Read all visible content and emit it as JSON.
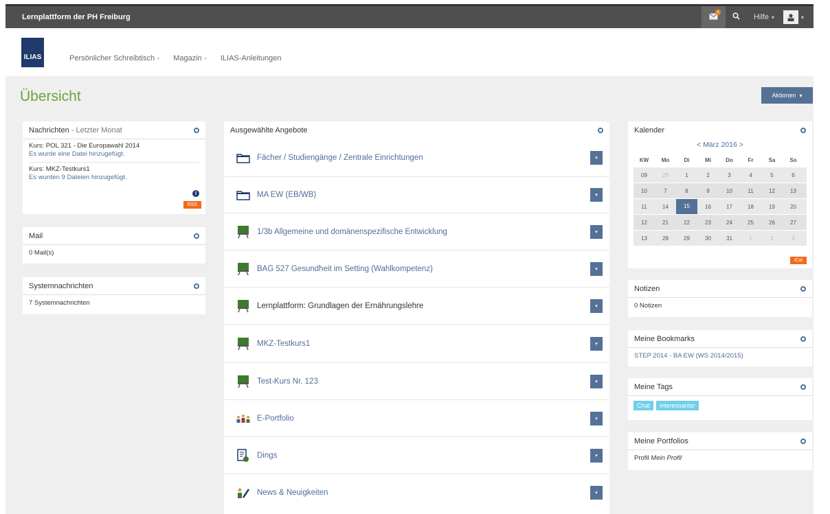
{
  "topbar": {
    "brand": "Lernplattform der PH Freiburg",
    "help_label": "Hilfe",
    "caret": "▾",
    "mail_badge": "!"
  },
  "header": {
    "logo_text": "ILIAS",
    "nav": [
      {
        "label": "Persönlicher Schreibtisch",
        "has_menu": true
      },
      {
        "label": "Magazin",
        "has_menu": true
      },
      {
        "label": "ILIAS-Anleitungen",
        "has_menu": false
      }
    ]
  },
  "page": {
    "title": "Übersicht",
    "actions_label": "Aktionen"
  },
  "left": {
    "news": {
      "title": "Nachrichten",
      "period": "- Letzter Monat",
      "items": [
        {
          "course": "Kurs: POL 321 - Die Europawahl 2014",
          "text": "Es wurde eine Datei hinzugefügt."
        },
        {
          "course": "Kurs: MKZ-Testkurs1",
          "text": "Es wurden 9 Dateien hinzugefügt."
        }
      ],
      "info": "i",
      "rss": "RSS"
    },
    "mail": {
      "title": "Mail",
      "text": "0 Mail(s)"
    },
    "system": {
      "title": "Systemnachrichten",
      "text": "7 Systemnachrichten"
    }
  },
  "center": {
    "title": "Ausgewählte Angebote",
    "items": [
      {
        "label": "Fächer / Studiengänge / Zentrale Einrichtungen",
        "icon": "folder-icon"
      },
      {
        "label": "MA EW (EB/WB)",
        "icon": "folder-icon"
      },
      {
        "label": "1/3b Allgemeine und domänenspezifische Entwicklung",
        "icon": "course-icon"
      },
      {
        "label": "BAG 527 Gesundheit im Setting (Wahlkompetenz)",
        "icon": "course-icon"
      },
      {
        "label": "Lernplattform: Grundlagen der Ernährungslehre",
        "icon": "course-icon"
      },
      {
        "label": "MKZ-Testkurs1",
        "icon": "course-icon"
      },
      {
        "label": "Test-Kurs Nr. 123",
        "icon": "course-icon"
      },
      {
        "label": "E-Portfolio",
        "icon": "group-icon"
      },
      {
        "label": "Dings",
        "icon": "survey-icon"
      },
      {
        "label": "News & Neuigkeiten",
        "icon": "blog-icon"
      }
    ]
  },
  "right": {
    "calendar": {
      "title": "Kalender",
      "month": "< März 2016 >",
      "headers": [
        "KW",
        "Mo",
        "Di",
        "Mi",
        "Do",
        "Fr",
        "Sa",
        "So"
      ],
      "weeks": [
        [
          "09",
          "29",
          "1",
          "2",
          "3",
          "4",
          "5",
          "6"
        ],
        [
          "10",
          "7",
          "8",
          "9",
          "10",
          "11",
          "12",
          "13"
        ],
        [
          "11",
          "14",
          "15",
          "16",
          "17",
          "18",
          "19",
          "20"
        ],
        [
          "12",
          "21",
          "22",
          "23",
          "24",
          "25",
          "26",
          "27"
        ],
        [
          "13",
          "28",
          "29",
          "30",
          "31",
          "1",
          "2",
          "3"
        ]
      ],
      "today": "15",
      "ical": "iCal"
    },
    "notes": {
      "title": "Notizen",
      "text": "0 Notizen"
    },
    "bookmarks": {
      "title": "Meine Bookmarks",
      "text": "STEP 2014 - BA EW (WS 2014/2015)"
    },
    "tags": {
      "title": "Meine Tags",
      "items": [
        "Chat",
        "interessanter"
      ]
    },
    "portfolios": {
      "title": "Meine Portfolios",
      "prefix": "Profil",
      "name": "Mein Profil"
    }
  },
  "colors": {
    "topbar": "#4f4f4f",
    "accent_blue": "#557196",
    "link_blue": "#4e6f9a",
    "title_green": "#6ea23c",
    "rss_orange": "#f36a1e",
    "tag_cyan": "#6fd0e8"
  }
}
